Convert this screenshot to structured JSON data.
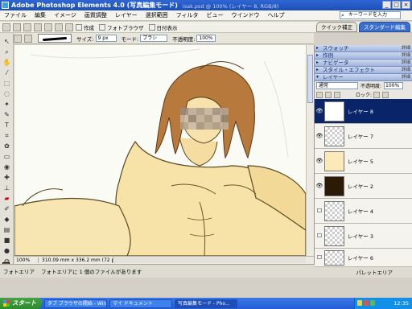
{
  "window": {
    "title": "Adobe Photoshop Elements 4.0 (写真編集モード)",
    "file_info": "isak.psd @ 100% (レイヤー 8, RGB/8)",
    "controls": [
      "_",
      "□",
      "×"
    ]
  },
  "menu": {
    "items": [
      "ファイル",
      "編集",
      "イメージ",
      "画質調整",
      "レイヤー",
      "選択範囲",
      "フィルタ",
      "ビュー",
      "ウインドウ",
      "ヘルプ"
    ],
    "search_placeholder": "キーワードを入力"
  },
  "shortcuts": {
    "create": "作成",
    "photo_browser": "フォトブラウザ",
    "date_view": "日付表示"
  },
  "mode_tabs": {
    "quick_fix": "クイック補正",
    "standard_edit": "スタンダード編集"
  },
  "options": {
    "size_label": "サイズ:",
    "size_value": "9 px",
    "mode_label": "モード:",
    "mode_value": "ブラシ",
    "opacity_label": "不透明度:",
    "opacity_value": "100%"
  },
  "status": {
    "zoom": "100%",
    "dimensions": "310.09 mm x 336.2 mm (72 ppi)"
  },
  "photo_bin": {
    "label": "フォトエリア",
    "message": "フォトエリアに 1 個のファイルがあります",
    "palette_area": "パレットエリア"
  },
  "palettes": {
    "headers": [
      {
        "label": "スウォッチ",
        "more": "詳細"
      },
      {
        "label": "作例",
        "more": "詳細"
      },
      {
        "label": "ナビゲータ",
        "more": "詳細"
      },
      {
        "label": "スタイル・エフェクト",
        "more": "詳細"
      },
      {
        "label": "レイヤー",
        "more": "詳細"
      }
    ],
    "layers": {
      "blend_mode": "通常",
      "opacity_label": "不透明度:",
      "opacity_value": "100%",
      "lock_label": "ロック:",
      "rows": [
        {
          "name": "レイヤー 8",
          "selected": true,
          "visible": true
        },
        {
          "name": "レイヤー 7",
          "selected": false,
          "visible": true
        },
        {
          "name": "レイヤー 5",
          "selected": false,
          "visible": true
        },
        {
          "name": "レイヤー 2",
          "selected": false,
          "visible": true
        },
        {
          "name": "レイヤー 4",
          "selected": false,
          "visible": false
        },
        {
          "name": "レイヤー 3",
          "selected": false,
          "visible": false
        },
        {
          "name": "レイヤー 6",
          "selected": false,
          "visible": false
        }
      ]
    }
  },
  "taskbar": {
    "start": "スタート",
    "items": [
      "タブ ブラウザの開始 - Win...",
      "マイ ドキュメント",
      "写真編集モード - Pho..."
    ],
    "clock": "12:35"
  },
  "colors": {
    "foreground": "#8b5a2b",
    "background": "#ffffff",
    "selected_layer": "#0a246a"
  }
}
